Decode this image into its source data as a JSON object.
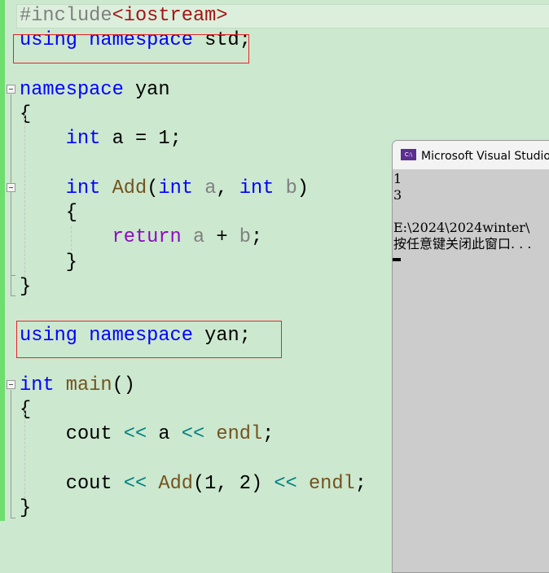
{
  "editor": {
    "lines": [
      [
        {
          "t": "#include",
          "c": "pp"
        },
        {
          "t": "<iostream>",
          "c": "st"
        }
      ],
      [
        {
          "t": "using",
          "c": "kw"
        },
        {
          "t": " ",
          "c": "tx"
        },
        {
          "t": "namespace",
          "c": "kw"
        },
        {
          "t": " std;",
          "c": "tx"
        }
      ],
      [],
      [
        {
          "t": "namespace",
          "c": "kw"
        },
        {
          "t": " yan",
          "c": "tx"
        }
      ],
      [
        {
          "t": "{",
          "c": "tx"
        }
      ],
      [
        {
          "t": "    ",
          "c": "tx"
        },
        {
          "t": "int",
          "c": "kw"
        },
        {
          "t": " a = 1;",
          "c": "tx"
        }
      ],
      [],
      [
        {
          "t": "    ",
          "c": "tx"
        },
        {
          "t": "int",
          "c": "kw"
        },
        {
          "t": " ",
          "c": "tx"
        },
        {
          "t": "Add",
          "c": "fn"
        },
        {
          "t": "(",
          "c": "tx"
        },
        {
          "t": "int",
          "c": "kw"
        },
        {
          "t": " ",
          "c": "tx"
        },
        {
          "t": "a",
          "c": "pm"
        },
        {
          "t": ", ",
          "c": "tx"
        },
        {
          "t": "int",
          "c": "kw"
        },
        {
          "t": " ",
          "c": "tx"
        },
        {
          "t": "b",
          "c": "pm"
        },
        {
          "t": ")",
          "c": "tx"
        }
      ],
      [
        {
          "t": "    {",
          "c": "tx"
        }
      ],
      [
        {
          "t": "        ",
          "c": "tx"
        },
        {
          "t": "return",
          "c": "ret"
        },
        {
          "t": " ",
          "c": "tx"
        },
        {
          "t": "a",
          "c": "pm"
        },
        {
          "t": " + ",
          "c": "tx"
        },
        {
          "t": "b",
          "c": "pm"
        },
        {
          "t": ";",
          "c": "tx"
        }
      ],
      [
        {
          "t": "    }",
          "c": "tx"
        }
      ],
      [
        {
          "t": "}",
          "c": "tx"
        }
      ],
      [],
      [
        {
          "t": "using",
          "c": "kw"
        },
        {
          "t": " ",
          "c": "tx"
        },
        {
          "t": "namespace",
          "c": "kw"
        },
        {
          "t": " yan;",
          "c": "tx"
        }
      ],
      [],
      [
        {
          "t": "int",
          "c": "kw"
        },
        {
          "t": " ",
          "c": "tx"
        },
        {
          "t": "main",
          "c": "fn"
        },
        {
          "t": "()",
          "c": "tx"
        }
      ],
      [
        {
          "t": "{",
          "c": "tx"
        }
      ],
      [
        {
          "t": "    cout ",
          "c": "tx"
        },
        {
          "t": "<<",
          "c": "op"
        },
        {
          "t": " a ",
          "c": "tx"
        },
        {
          "t": "<<",
          "c": "op"
        },
        {
          "t": " ",
          "c": "tx"
        },
        {
          "t": "endl",
          "c": "fn"
        },
        {
          "t": ";",
          "c": "tx"
        }
      ],
      [],
      [
        {
          "t": "    cout ",
          "c": "tx"
        },
        {
          "t": "<<",
          "c": "op"
        },
        {
          "t": " ",
          "c": "tx"
        },
        {
          "t": "Add",
          "c": "fn"
        },
        {
          "t": "(1, 2) ",
          "c": "tx"
        },
        {
          "t": "<<",
          "c": "op"
        },
        {
          "t": " ",
          "c": "tx"
        },
        {
          "t": "endl",
          "c": "fn"
        },
        {
          "t": ";",
          "c": "tx"
        }
      ],
      [
        {
          "t": "}",
          "c": "tx"
        }
      ]
    ]
  },
  "console": {
    "title": "Microsoft Visual Studio 调试控制台",
    "icon": "console-app-icon",
    "icon_text": "C:\\",
    "output": "1\n3\n\nE:\\2024\\2024winter\\\n按任意键关闭此窗口. . ."
  },
  "colors": {
    "background": "#cce8cf",
    "keyword": "#0000ff",
    "function": "#74531f",
    "highlight_box": "#e8242a"
  }
}
